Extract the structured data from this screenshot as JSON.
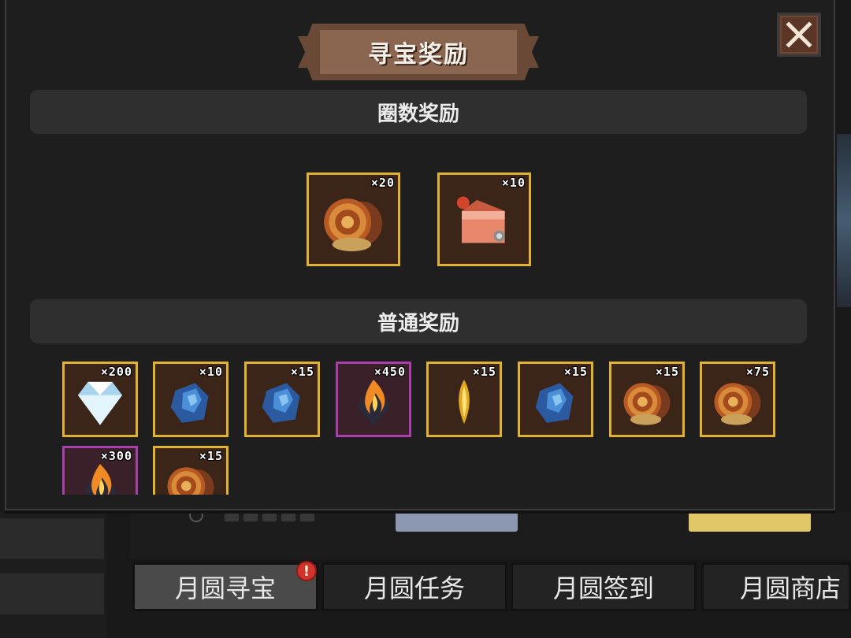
{
  "title": "寻宝奖励",
  "sections": {
    "lap_rewards": "圈数奖励",
    "normal_rewards": "普通奖励"
  },
  "lap_items": [
    {
      "icon": "mooncake-icon",
      "count": "×20"
    },
    {
      "icon": "lantern-pack-icon",
      "count": "×10"
    }
  ],
  "normal_items": [
    {
      "icon": "diamond-icon",
      "count": "×200",
      "rarity": "gold"
    },
    {
      "icon": "blue-ore-icon",
      "count": "×10",
      "rarity": "gold"
    },
    {
      "icon": "blue-ore-icon",
      "count": "×15",
      "rarity": "gold"
    },
    {
      "icon": "flame-crystal-icon",
      "count": "×450",
      "rarity": "epic"
    },
    {
      "icon": "golden-feather-icon",
      "count": "×15",
      "rarity": "gold"
    },
    {
      "icon": "blue-ore-icon",
      "count": "×15",
      "rarity": "gold"
    },
    {
      "icon": "mooncake-icon",
      "count": "×15",
      "rarity": "gold"
    },
    {
      "icon": "mooncake-icon",
      "count": "×75",
      "rarity": "gold"
    },
    {
      "icon": "flame-crystal-icon",
      "count": "×300",
      "rarity": "epic"
    },
    {
      "icon": "mooncake-icon",
      "count": "×15",
      "rarity": "gold"
    }
  ],
  "tabs": [
    {
      "label": "月圆寻宝",
      "active": true,
      "alert": "!"
    },
    {
      "label": "月圆任务",
      "active": false
    },
    {
      "label": "月圆签到",
      "active": false
    },
    {
      "label": "月圆商店",
      "active": false
    }
  ],
  "colors": {
    "gold_border": "#e0b230",
    "epic_border": "#a93fa9",
    "banner": "#8a6650",
    "alert": "#d0342c"
  }
}
